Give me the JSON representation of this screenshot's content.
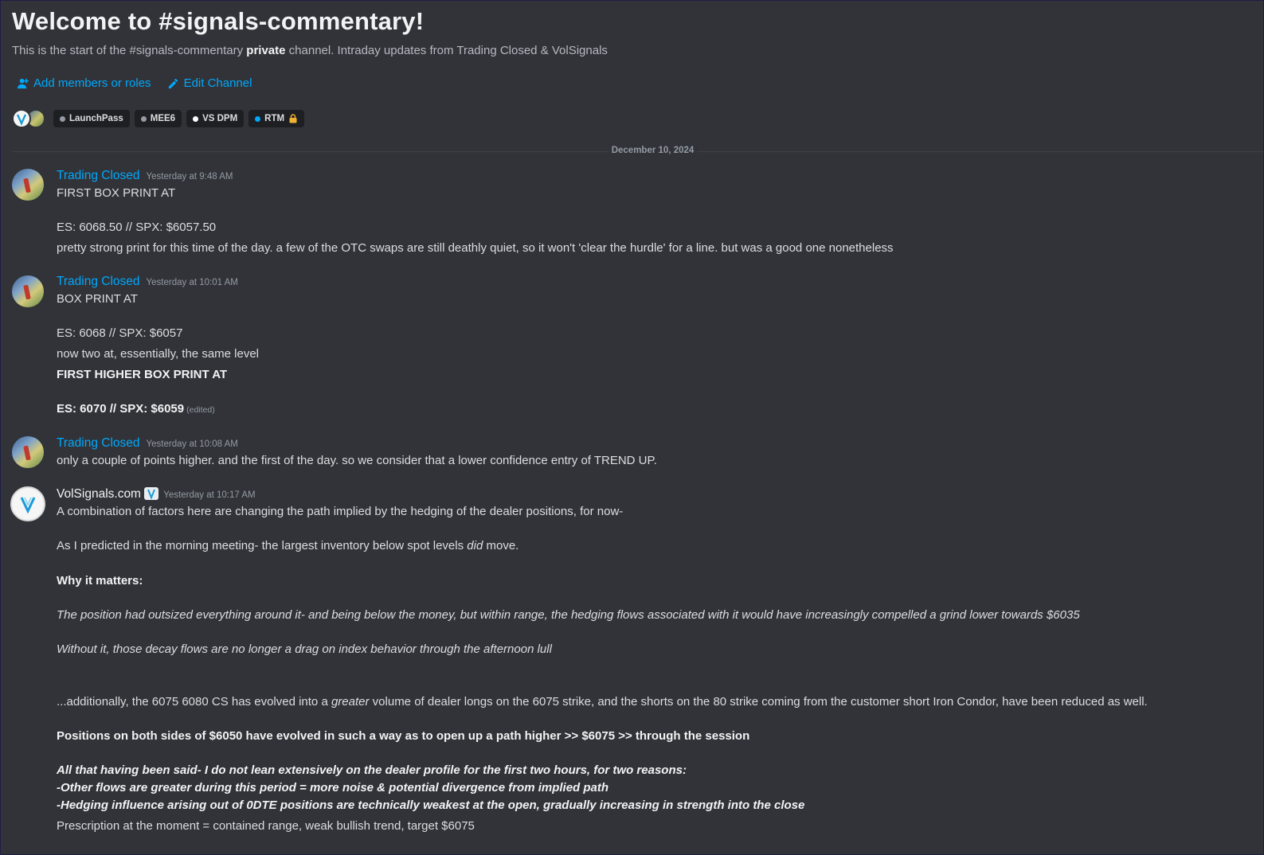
{
  "header": {
    "title": "Welcome to #signals-commentary!",
    "desc_prefix": "This is the start of the #signals-commentary",
    "desc_bold": "private",
    "desc_suffix": "channel. Intraday updates from Trading Closed & VolSignals"
  },
  "actions": {
    "add_members": "Add members or roles",
    "edit_channel": "Edit Channel"
  },
  "roles": [
    {
      "label": "LaunchPass",
      "color": "#949ba4"
    },
    {
      "label": "MEE6",
      "color": "#949ba4"
    },
    {
      "label": "VS DPM",
      "color": "#ffffff"
    },
    {
      "label": "RTM",
      "color": "#00a8fc",
      "icon": "lock-icon"
    }
  ],
  "date_divider": "December 10, 2024",
  "messages": [
    {
      "author": "Trading Closed",
      "timestamp": "Yesterday at 9:48 AM",
      "lines": [
        "FIRST BOX PRINT AT",
        "ES: 6068.50 // SPX: $6057.50",
        "pretty strong print for this time of the day. a few of the OTC swaps are still deathly quiet, so it won't 'clear the hurdle' for a line. but was a good one nonetheless"
      ]
    },
    {
      "author": "Trading Closed",
      "timestamp": "Yesterday at 10:01 AM",
      "lines": [
        "BOX PRINT AT",
        "ES: 6068 // SPX: $6057",
        "now two at, essentially, the same level",
        "FIRST HIGHER BOX PRINT AT",
        "ES: 6070 // SPX: $6059"
      ],
      "edited": "(edited)"
    },
    {
      "author": "Trading Closed",
      "timestamp": "Yesterday at 10:08 AM",
      "lines": [
        "only a couple of points higher. and the first of the day. so we consider that a lower confidence entry of TREND UP."
      ]
    },
    {
      "author": "VolSignals.com",
      "timestamp": "Yesterday at 10:17 AM",
      "lines": [
        "A combination of factors here are changing the path implied by the hedging of the dealer positions, for now-",
        "As I predicted in the morning meeting- the largest inventory below spot levels",
        "did",
        "move.",
        "Why it matters:",
        "The position had outsized everything around it- and being below the money, but within range, the hedging flows associated with it would have increasingly compelled a grind lower towards $6035",
        "Without it, those decay flows are no longer a drag on index behavior through the afternoon lull",
        "...additionally, the 6075 6080 CS has evolved into a",
        "greater",
        "volume of dealer longs on the 6075 strike, and the shorts on the 80 strike coming from the customer short Iron Condor, have been reduced as well.",
        "Positions on both sides of $6050 have evolved in such a way as to open up a path higher >> $6075 >> through the session",
        "All that having been said- I do not lean extensively on the dealer profile for the first two hours, for two reasons:",
        "-Other flows are greater during this period = more noise & potential divergence from implied path",
        "-Hedging influence arising out of 0DTE positions are technically weakest at the open, gradually increasing in strength into the close",
        "Prescription at the moment = contained range, weak bullish trend, target $6075"
      ]
    }
  ]
}
